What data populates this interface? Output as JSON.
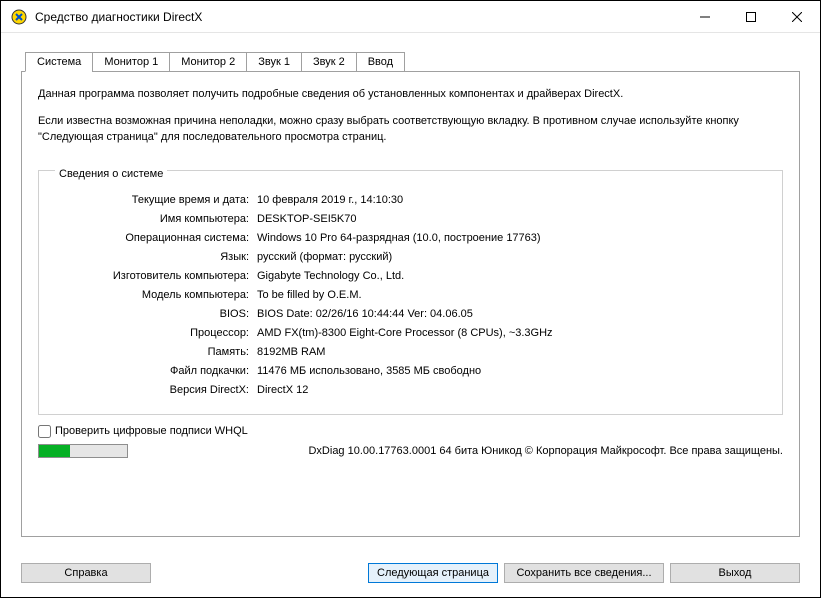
{
  "window": {
    "title": "Средство диагностики DirectX"
  },
  "tabs": [
    {
      "label": "Система"
    },
    {
      "label": "Монитор 1"
    },
    {
      "label": "Монитор 2"
    },
    {
      "label": "Звук 1"
    },
    {
      "label": "Звук 2"
    },
    {
      "label": "Ввод"
    }
  ],
  "intro": {
    "p1": "Данная программа позволяет получить подробные сведения об установленных компонентах и драйверах DirectX.",
    "p2": "Если известна возможная причина неполадки, можно сразу выбрать соответствующую вкладку. В противном случае используйте кнопку \"Следующая страница\" для последовательного просмотра страниц."
  },
  "fieldset": {
    "title": "Сведения о системе"
  },
  "info": {
    "datetime": {
      "label": "Текущие время и дата:",
      "value": "10 февраля 2019 г., 14:10:30"
    },
    "computer": {
      "label": "Имя компьютера:",
      "value": "DESKTOP-SEI5K70"
    },
    "os": {
      "label": "Операционная система:",
      "value": "Windows 10 Pro 64-разрядная (10.0, построение 17763)"
    },
    "lang": {
      "label": "Язык:",
      "value": "русский (формат: русский)"
    },
    "manufacturer": {
      "label": "Изготовитель компьютера:",
      "value": "Gigabyte Technology Co., Ltd."
    },
    "model": {
      "label": "Модель компьютера:",
      "value": "To be filled by O.E.M."
    },
    "bios": {
      "label": "BIOS:",
      "value": "BIOS Date: 02/26/16 10:44:44 Ver: 04.06.05"
    },
    "cpu": {
      "label": "Процессор:",
      "value": "AMD FX(tm)-8300 Eight-Core Processor            (8 CPUs), ~3.3GHz"
    },
    "memory": {
      "label": "Память:",
      "value": "8192MB RAM"
    },
    "pagefile": {
      "label": "Файл подкачки:",
      "value": "11476 МБ использовано, 3585 МБ свободно"
    },
    "directx": {
      "label": "Версия DirectX:",
      "value": "DirectX 12"
    }
  },
  "checkbox": {
    "label": "Проверить цифровые подписи WHQL"
  },
  "status": {
    "progress_pct": 35,
    "text": "DxDiag 10.00.17763.0001 64 бита Юникод © Корпорация Майкрософт. Все права защищены."
  },
  "buttons": {
    "help": "Справка",
    "next": "Следующая страница",
    "save": "Сохранить все сведения...",
    "exit": "Выход"
  }
}
